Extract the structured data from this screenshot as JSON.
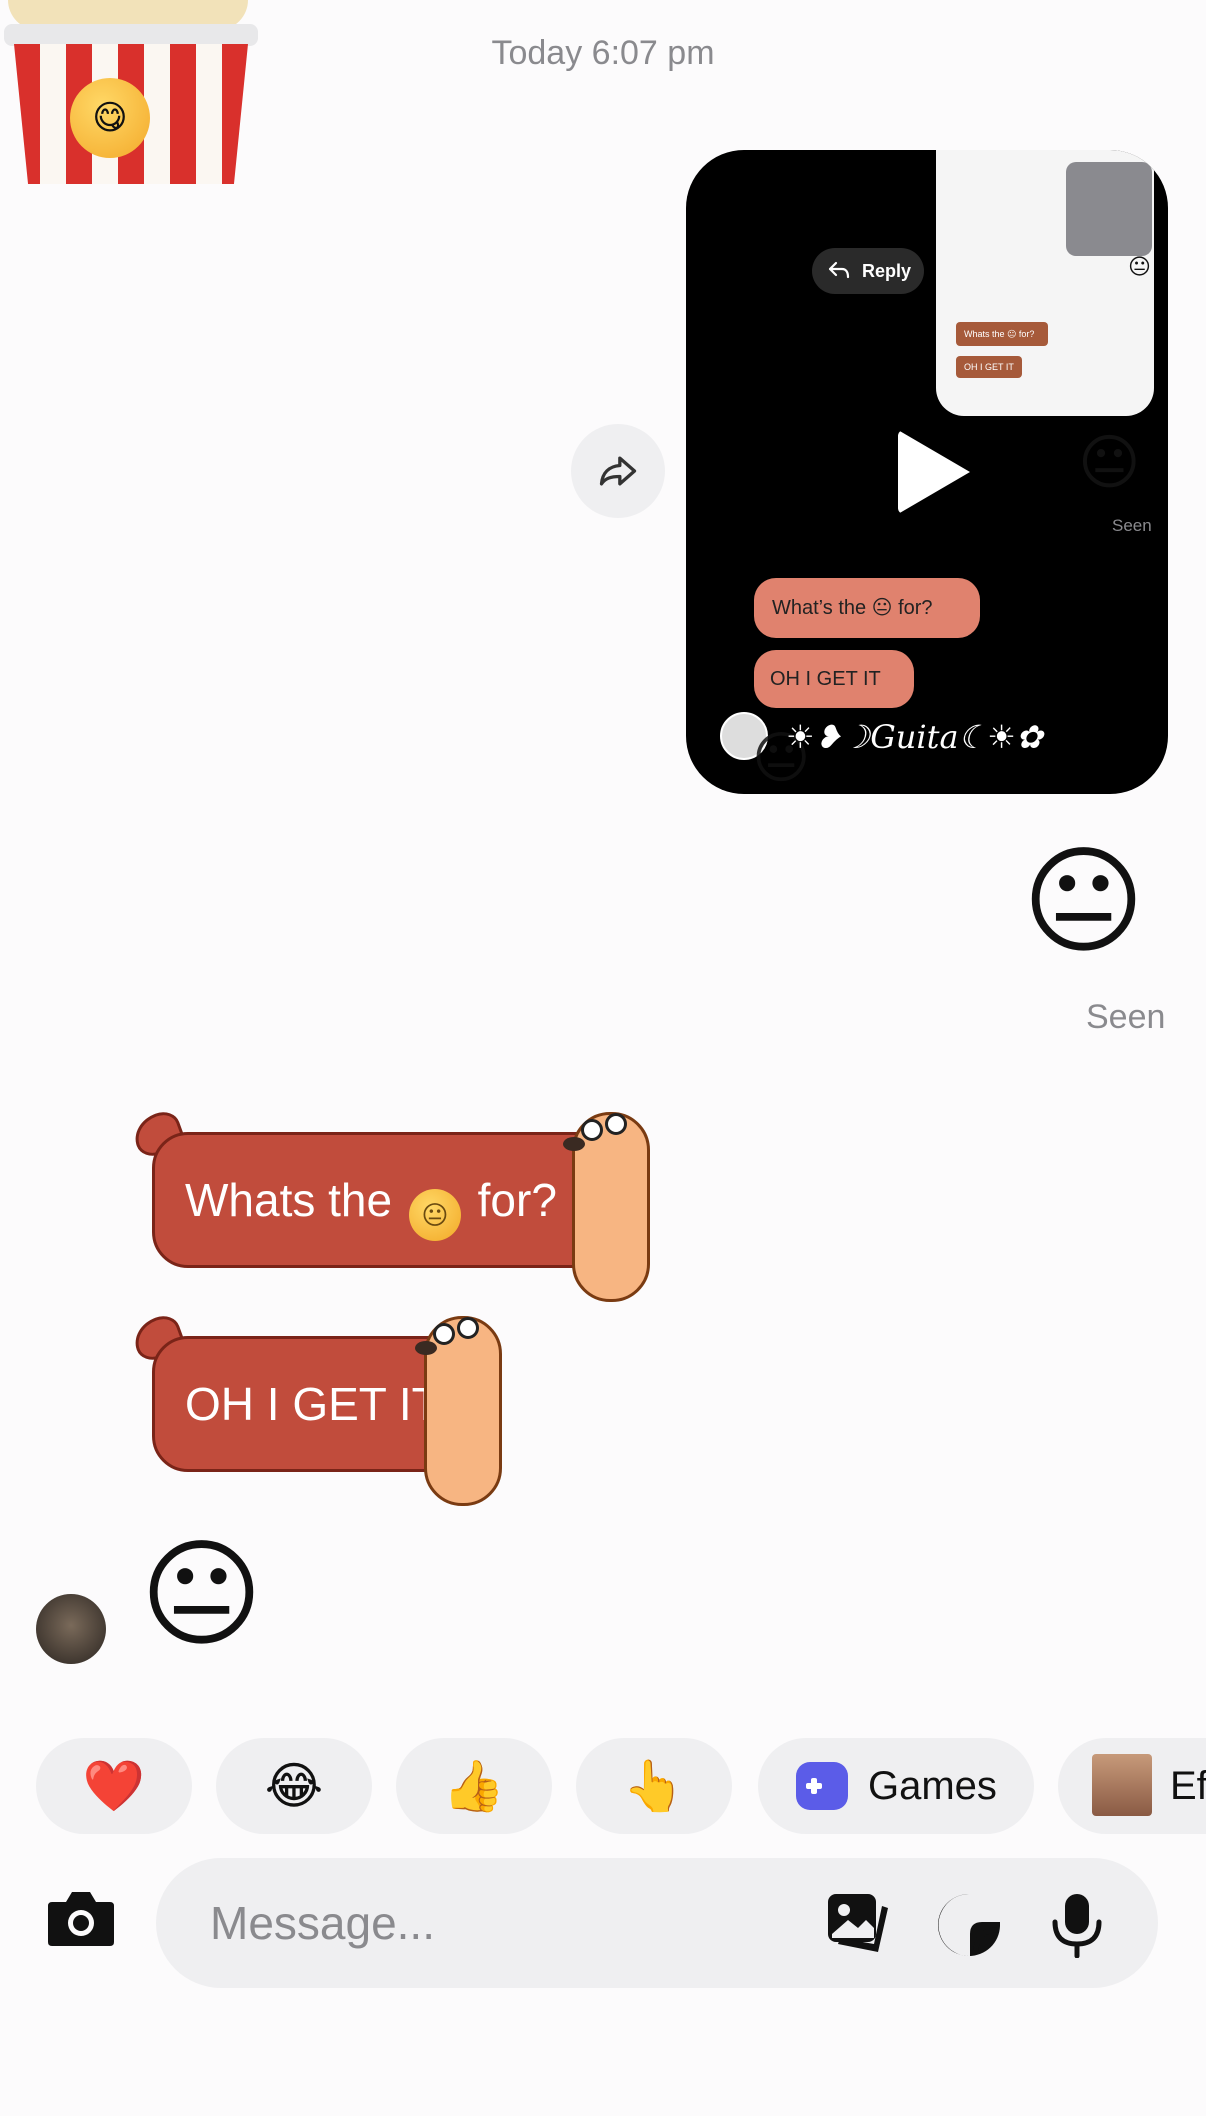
{
  "timestamp": "Today 6:07 pm",
  "shared_video": {
    "reply_label": "Reply",
    "seen_label": "Seen",
    "bubble_1": "What’s the 😐 for?",
    "bubble_2": "OH I GET IT",
    "name_text": "☀︎❥☽Guita☾☀︎✿",
    "emoji": "😐",
    "thumb_bubble_1": "Whats the 😐 for?",
    "thumb_bubble_2": "OH I GET IT"
  },
  "outgoing_emoji": "😐",
  "seen_label": "Seen",
  "incoming": {
    "sticker_1": {
      "before": "Whats the",
      "emoji": "😐",
      "after": "for?"
    },
    "sticker_2": "OH I GET IT",
    "emoji": "😐"
  },
  "popcorn_emoji": "😋",
  "quick_reactions": [
    "❤️",
    "😂",
    "👍",
    "👆"
  ],
  "games_label": "Games",
  "effects_label": "Effects",
  "composer": {
    "placeholder": "Message..."
  },
  "colors": {
    "sticker_red": "#c14c3c",
    "games_purple": "#5b5ce8",
    "chip_bg": "#efeff1"
  }
}
